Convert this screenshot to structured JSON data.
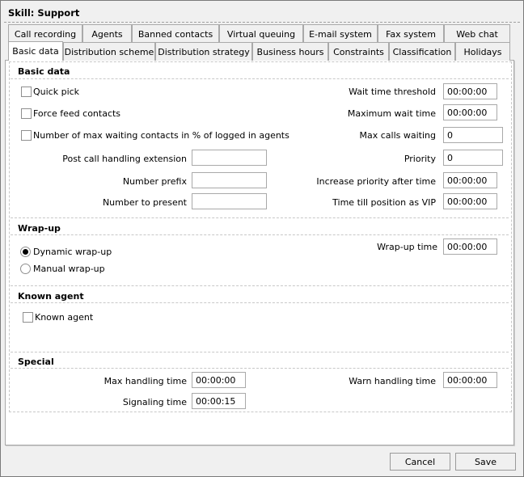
{
  "window": {
    "title": "Skill: Support"
  },
  "tabs_row1": [
    "Call recording",
    "Agents",
    "Banned contacts",
    "Virtual queuing",
    "E-mail system",
    "Fax system",
    "Web chat"
  ],
  "tabs_row2": [
    "Basic data",
    "Distribution scheme",
    "Distribution strategy",
    "Business hours",
    "Constraints",
    "Classification",
    "Holidays"
  ],
  "active_tab": "Basic data",
  "basic": {
    "title": "Basic data",
    "quick_pick": "Quick pick",
    "force_feed": "Force feed contacts",
    "max_waiting_pct": "Number of max waiting contacts in % of logged in agents",
    "post_call_ext": {
      "label": "Post call handling extension",
      "value": ""
    },
    "number_prefix": {
      "label": "Number prefix",
      "value": ""
    },
    "number_present": {
      "label": "Number to present",
      "value": ""
    },
    "wait_threshold": {
      "label": "Wait time threshold",
      "value": "00:00:00"
    },
    "max_wait": {
      "label": "Maximum wait time",
      "value": "00:00:00"
    },
    "max_calls": {
      "label": "Max calls waiting",
      "value": "0"
    },
    "priority": {
      "label": "Priority",
      "value": "0"
    },
    "increase_priority": {
      "label": "Increase priority after time",
      "value": "00:00:00"
    },
    "vip_time": {
      "label": "Time till position as VIP",
      "value": "00:00:00"
    }
  },
  "wrapup": {
    "title": "Wrap-up",
    "dynamic": "Dynamic wrap-up",
    "manual": "Manual wrap-up",
    "time": {
      "label": "Wrap-up time",
      "value": "00:00:00"
    }
  },
  "known": {
    "title": "Known agent",
    "checkbox": "Known agent"
  },
  "special": {
    "title": "Special",
    "max_handling": {
      "label": "Max handling time",
      "value": "00:00:00"
    },
    "signaling": {
      "label": "Signaling time",
      "value": "00:00:15"
    },
    "warn_handling": {
      "label": "Warn handling time",
      "value": "00:00:00"
    }
  },
  "buttons": {
    "cancel": "Cancel",
    "save": "Save"
  }
}
